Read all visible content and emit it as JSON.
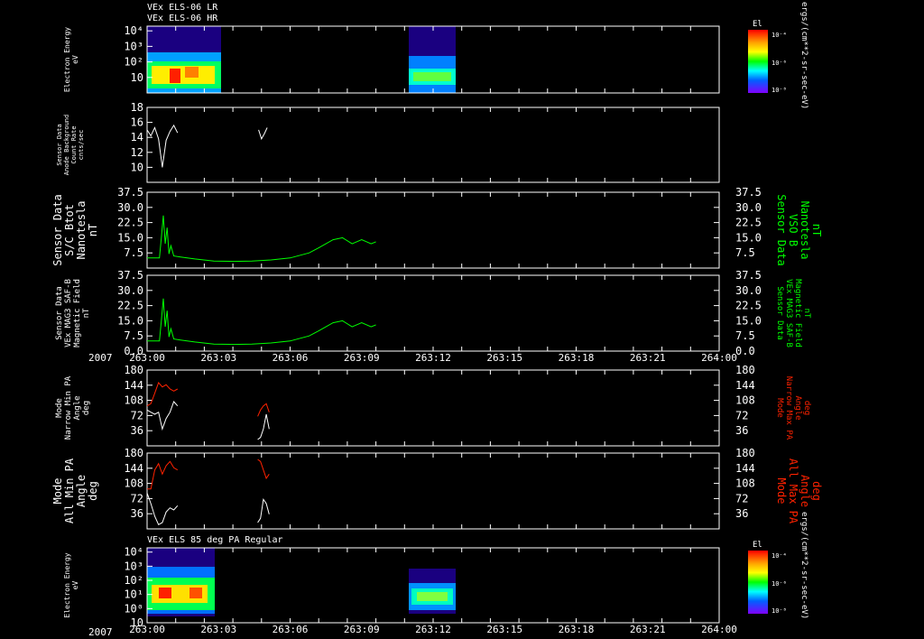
{
  "titles": {
    "top_line1": "VEx ELS-06 LR",
    "top_line2": "VEx ELS-06 HR",
    "bottom_panel": "VEx ELS 85 deg PA Regular"
  },
  "year_label": "2007",
  "colors": {
    "background": "#000000",
    "axis": "#ffffff",
    "green": "#00ff00",
    "red": "#ff2200",
    "white": "#ffffff"
  },
  "colorbars": [
    {
      "title": "El",
      "ticks": [
        "10⁻⁴",
        "10⁻⁶",
        "10⁻⁸"
      ],
      "units": "ergs/(cm**2-sr-sec-eV)"
    },
    {
      "title": "El",
      "ticks": [
        "10⁻⁴",
        "10⁻⁶",
        "10⁻⁸"
      ],
      "units": "ergs/(cm**2-sr-sec-eV)"
    }
  ],
  "chart_data": {
    "type": "line",
    "x_range_hhmm": [
      "263:00",
      "264:00"
    ],
    "x_tick_labels": [
      "263:00",
      "263:03",
      "263:06",
      "263:09",
      "263:12",
      "263:15",
      "263:18",
      "263:21",
      "264:00"
    ],
    "data_gaps_minutes": [
      [
        3.3,
        11.7
      ],
      [
        12.8,
        60
      ]
    ],
    "panels": [
      {
        "id": "electron_energy_hr",
        "type": "heatmap",
        "ylabel": [
          "Electron Energy",
          "eV"
        ],
        "log_scale": true,
        "y_ticks": [
          "10⁴",
          "10³",
          "10²",
          "10"
        ],
        "y_tick_values": [
          10000,
          1000,
          100,
          10
        ],
        "ylim": [
          1,
          20000
        ],
        "coverage_minutes": [
          [
            0,
            3.3
          ],
          [
            11.7,
            12.7
          ]
        ],
        "peak_energy_eV": [
          5,
          40
        ]
      },
      {
        "id": "sensor_angle_background",
        "type": "line",
        "ylabel": [
          "Sensor Data",
          "Anode Background",
          "Count Rate",
          "cnts/sec"
        ],
        "y_ticks": [
          "18",
          "16",
          "14",
          "12",
          "10"
        ],
        "ylim": [
          8,
          18
        ],
        "series": [
          {
            "color": "white",
            "x": [
              0.0,
              0.4,
              0.8,
              1.2,
              1.6,
              2.0,
              2.4,
              2.8,
              3.2,
              11.7,
              12.0,
              12.3,
              12.6
            ],
            "y": [
              15.0,
              14.2,
              15.3,
              13.8,
              10.0,
              13.6,
              14.8,
              15.6,
              14.6,
              15.0,
              13.8,
              14.5,
              15.3
            ]
          }
        ]
      },
      {
        "id": "sc_btot",
        "type": "line",
        "ylabel": [
          "Sensor Data",
          "S/C Btot",
          "Nanotesla",
          "nT"
        ],
        "ylabel_right": [
          "Sensor Data",
          "VSO B",
          "Nanotesla",
          "nT"
        ],
        "y_ticks": [
          "37.5",
          "30.0",
          "22.5",
          "15.0",
          "7.5"
        ],
        "ylim": [
          0,
          37.5
        ],
        "series": [
          {
            "color": "green",
            "x": [
              0,
              0.5,
              1.0,
              1.3,
              1.5,
              1.7,
              1.9,
              2.1,
              2.3,
              2.5,
              2.8,
              3.5,
              5,
              7,
              9,
              11,
              13,
              15,
              17,
              18,
              19.5,
              20.5,
              21.5,
              22.5,
              23.5,
              24
            ],
            "y": [
              5,
              5,
              5,
              5,
              15,
              26,
              12,
              20,
              7,
              11,
              6,
              5.5,
              4.5,
              3.5,
              3.3,
              3.5,
              4,
              5,
              7.5,
              10,
              14,
              15,
              12,
              14,
              12,
              13
            ]
          }
        ]
      },
      {
        "id": "mag_field",
        "type": "line",
        "ylabel": [
          "Sensor Data",
          "VEx MAG3 SAF-B",
          "Magnetic Field",
          "nT"
        ],
        "ylabel_right": [
          "Sensor Data",
          "VEx MAG3 SAF-B",
          "Magnetic Field",
          "nT"
        ],
        "y_ticks": [
          "37.5",
          "30.0",
          "22.5",
          "15.0",
          "7.5",
          "0.0"
        ],
        "ylim": [
          0,
          37.5
        ],
        "series": [
          {
            "color": "green",
            "x": [
              0,
              0.5,
              1.0,
              1.3,
              1.5,
              1.7,
              1.9,
              2.1,
              2.3,
              2.5,
              2.8,
              3.5,
              5,
              7,
              9,
              11,
              13,
              15,
              17,
              18,
              19.5,
              20.5,
              21.5,
              22.5,
              23.5,
              24
            ],
            "y": [
              5,
              5,
              5,
              5,
              15,
              26,
              12,
              20,
              7,
              11,
              6,
              5.5,
              4.5,
              3.5,
              3.3,
              3.5,
              4,
              5,
              7.5,
              10,
              14,
              15,
              12,
              14,
              12,
              13
            ]
          }
        ]
      },
      {
        "id": "narrow_pa",
        "type": "line",
        "ylabel": [
          "Mode",
          "Narrow Min PA",
          "Angle",
          "deg"
        ],
        "ylabel_right": [
          "Mode",
          "Narrow Max PA",
          "Angle",
          "deg"
        ],
        "y_ticks": [
          "180",
          "144",
          "108",
          "72",
          "36"
        ],
        "ylim": [
          0,
          180
        ],
        "series": [
          {
            "color": "red",
            "x": [
              0,
              0.4,
              0.8,
              1.2,
              1.6,
              2.0,
              2.4,
              2.8,
              3.2,
              11.6,
              11.9,
              12.2,
              12.5,
              12.8
            ],
            "y": [
              95,
              100,
              125,
              150,
              140,
              145,
              135,
              130,
              135,
              70,
              85,
              95,
              100,
              80
            ]
          },
          {
            "color": "white",
            "x": [
              0,
              0.4,
              0.8,
              1.2,
              1.6,
              2.0,
              2.4,
              2.8,
              3.2,
              11.6,
              11.9,
              12.2,
              12.5,
              12.8
            ],
            "y": [
              85,
              80,
              75,
              80,
              40,
              65,
              80,
              105,
              95,
              15,
              20,
              40,
              75,
              40
            ]
          }
        ]
      },
      {
        "id": "all_pa",
        "type": "line",
        "ylabel": [
          "Mode",
          "All Min PA",
          "Angle",
          "deg"
        ],
        "ylabel_right": [
          "Mode",
          "All Max PA",
          "Angle",
          "deg"
        ],
        "y_ticks": [
          "180",
          "144",
          "108",
          "72",
          "36"
        ],
        "ylim": [
          0,
          180
        ],
        "series": [
          {
            "color": "red",
            "x": [
              0,
              0.4,
              0.8,
              1.2,
              1.6,
              2.0,
              2.4,
              2.8,
              3.2,
              11.6,
              11.9,
              12.2,
              12.5,
              12.8
            ],
            "y": [
              95,
              95,
              140,
              155,
              130,
              150,
              160,
              145,
              140,
              165,
              160,
              140,
              120,
              130
            ]
          },
          {
            "color": "white",
            "x": [
              0,
              0.4,
              0.8,
              1.2,
              1.6,
              2.0,
              2.4,
              2.8,
              3.2,
              11.6,
              11.9,
              12.2,
              12.5,
              12.8
            ],
            "y": [
              85,
              60,
              30,
              10,
              15,
              40,
              50,
              45,
              55,
              15,
              25,
              70,
              60,
              35
            ]
          }
        ]
      },
      {
        "id": "electron_energy_85",
        "type": "heatmap",
        "ylabel": [
          "Electron Energy",
          "eV"
        ],
        "log_scale": true,
        "y_ticks": [
          "10⁴",
          "10³",
          "10²",
          "10¹",
          "10⁰",
          "10"
        ],
        "y_tick_values": [
          10000,
          1000,
          100,
          10,
          1,
          0.1
        ],
        "ylim": [
          0.1,
          20000
        ],
        "coverage_minutes": [
          [
            0,
            3.0
          ],
          [
            11.7,
            12.7
          ]
        ],
        "peak_energy_eV": [
          3,
          30
        ]
      }
    ]
  }
}
